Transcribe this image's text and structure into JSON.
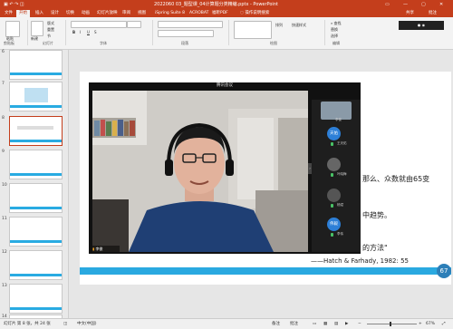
{
  "window": {
    "title": "2022060 03_题型课_04计算题分类精编.pptx - PowerPoint",
    "search_placeholder": "操作说明搜索",
    "tabs": [
      "文件",
      "开始",
      "插入",
      "设计",
      "切换",
      "动画",
      "幻灯片放映",
      "审阅",
      "视图",
      "iSpring Suite 8",
      "ACROBAT",
      "福昕PDF",
      "操作说明搜索"
    ]
  },
  "ribbon": {
    "groups": [
      {
        "name": "剪贴板",
        "buttons": [
          "粘贴"
        ]
      },
      {
        "name": "幻灯片",
        "buttons": [
          "新建",
          "幻灯片",
          "版式",
          "重置",
          "节"
        ]
      },
      {
        "name": "字体",
        "buttons": [
          "B",
          "I",
          "U",
          "S"
        ]
      },
      {
        "name": "段落",
        "buttons": []
      },
      {
        "name": "绘图",
        "buttons": [
          "排列",
          "快速样式"
        ]
      },
      {
        "name": "编辑",
        "buttons": [
          "查找",
          "替换",
          "选择"
        ]
      }
    ],
    "share": "共享",
    "comment": "批注"
  },
  "thumbnails": [
    {
      "num": "6"
    },
    {
      "num": "7"
    },
    {
      "num": "8"
    },
    {
      "num": "9"
    },
    {
      "num": "10"
    },
    {
      "num": "11"
    },
    {
      "num": "12"
    },
    {
      "num": "13"
    },
    {
      "num": "14"
    }
  ],
  "slide": {
    "text_line1": "那么、众数就由65变",
    "text_line2": "中趋势。",
    "text_line3": "的方法\"",
    "citation": "——Hatch & Farhady, 1982: 55"
  },
  "meeting": {
    "title": "腾讯会议",
    "speaker": "李俊",
    "participants": [
      {
        "name": "李俊",
        "avatar": "photo"
      },
      {
        "name": "王天佑",
        "avatar": "天佑"
      },
      {
        "name": "叶晓梅",
        "avatar": "dark"
      },
      {
        "name": "杨斌",
        "avatar": "dark"
      },
      {
        "name": "李伟",
        "avatar": "伟毅"
      }
    ]
  },
  "status": {
    "slide_info": "幻灯片 第 8 张，共 24 张",
    "language": "中文(中国)",
    "zoom_value": "67",
    "zoom_percent": "67%",
    "notes": "备注",
    "comments": "批注"
  },
  "colors": {
    "accent": "#c43e1c",
    "slide_bar": "#2aa9e0",
    "avatar_blue": "#2d7fd7"
  }
}
